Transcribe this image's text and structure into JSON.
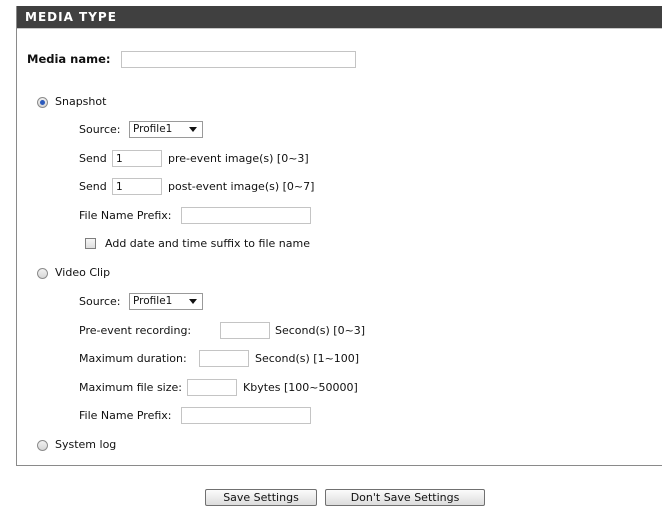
{
  "section": {
    "title": "MEDIA TYPE"
  },
  "media_name": {
    "label": "Media name:",
    "value": ""
  },
  "snapshot": {
    "label": "Snapshot",
    "selected": true,
    "source_label": "Source:",
    "source_value": "Profile1",
    "send_label": "Send",
    "pre_value": "1",
    "pre_suffix": "pre-event image(s) [0~3]",
    "post_value": "1",
    "post_suffix": "post-event image(s) [0~7]",
    "prefix_label": "File Name Prefix:",
    "prefix_value": "",
    "suffix_checkbox_label": "Add date and time suffix to file name",
    "suffix_checked": false
  },
  "video_clip": {
    "label": "Video Clip",
    "selected": false,
    "source_label": "Source:",
    "source_value": "Profile1",
    "pre_event_label": "Pre-event recording:",
    "pre_event_value": "",
    "pre_event_suffix": "Second(s) [0~3]",
    "max_duration_label": "Maximum duration:",
    "max_duration_value": "",
    "max_duration_suffix": "Second(s) [1~100]",
    "max_file_label": "Maximum file size:",
    "max_file_value": "",
    "max_file_suffix": "Kbytes [100~50000]",
    "prefix_label": "File Name Prefix:",
    "prefix_value": ""
  },
  "system_log": {
    "label": "System log",
    "selected": false
  },
  "buttons": {
    "save": "Save Settings",
    "dont_save": "Don't Save Settings"
  }
}
